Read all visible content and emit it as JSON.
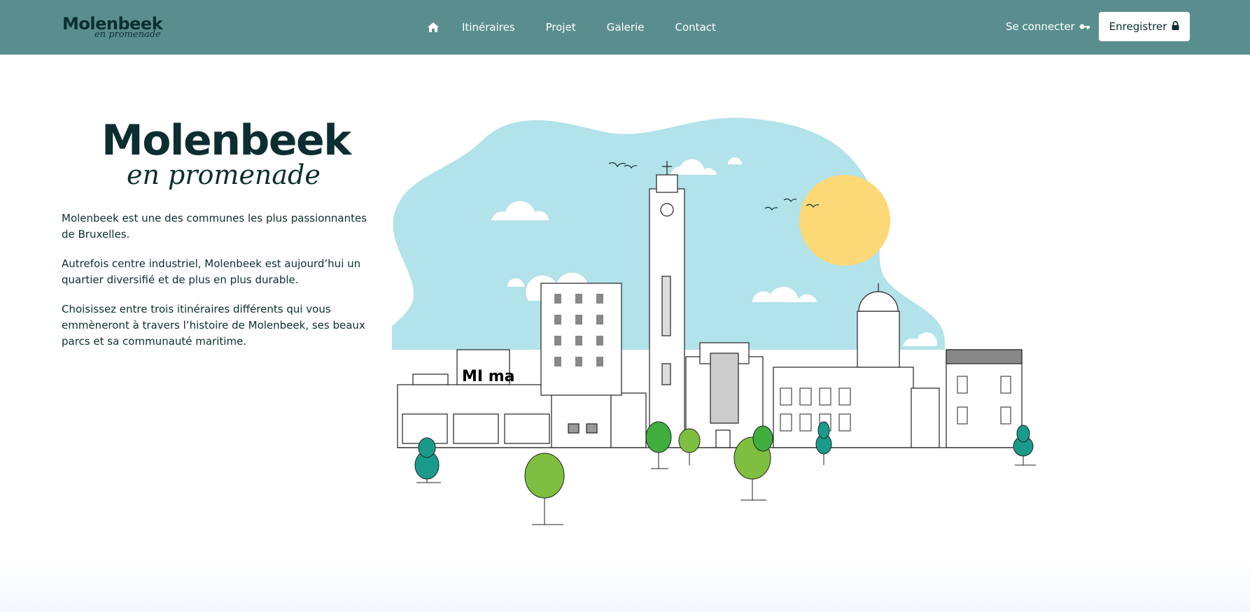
{
  "nav": {
    "logo_main": "Molenbeek",
    "logo_sub": "en promenade",
    "home_icon": "home-icon",
    "links": [
      "Itinéraires",
      "Projet",
      "Galerie",
      "Contact"
    ],
    "login_label": "Se connecter",
    "login_icon": "key-icon",
    "register_label": "Enregistrer",
    "register_icon": "lock-icon"
  },
  "hero": {
    "logo_main": "Molenbeek",
    "logo_sub": "en promenade",
    "paragraphs": [
      "Molenbeek est une des communes les plus passionnantes de Bruxelles.",
      "Autrefois centre industriel, Molenbeek est aujourd’hui un quartier diversifié et de plus en plus durable.",
      "Choisissez entre trois itinéraires différents qui vous emmèneront à travers l’histoire de Molenbeek, ses beaux parcs et sa communauté maritime."
    ],
    "illustration_sign": "MI ma"
  },
  "colors": {
    "navbar": "#5a8e8e",
    "brand_dark": "#0c2e30",
    "sky": "#b2e2ea",
    "sun": "#fcd877",
    "tree_green": "#7fbf3f",
    "tree_teal": "#1a9a8a"
  }
}
